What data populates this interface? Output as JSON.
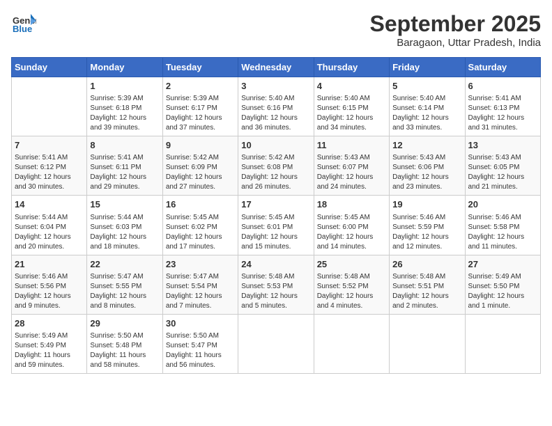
{
  "header": {
    "logo_line1": "General",
    "logo_line2": "Blue",
    "month": "September 2025",
    "location": "Baragaon, Uttar Pradesh, India"
  },
  "weekdays": [
    "Sunday",
    "Monday",
    "Tuesday",
    "Wednesday",
    "Thursday",
    "Friday",
    "Saturday"
  ],
  "weeks": [
    [
      {
        "day": "",
        "info": ""
      },
      {
        "day": "1",
        "info": "Sunrise: 5:39 AM\nSunset: 6:18 PM\nDaylight: 12 hours\nand 39 minutes."
      },
      {
        "day": "2",
        "info": "Sunrise: 5:39 AM\nSunset: 6:17 PM\nDaylight: 12 hours\nand 37 minutes."
      },
      {
        "day": "3",
        "info": "Sunrise: 5:40 AM\nSunset: 6:16 PM\nDaylight: 12 hours\nand 36 minutes."
      },
      {
        "day": "4",
        "info": "Sunrise: 5:40 AM\nSunset: 6:15 PM\nDaylight: 12 hours\nand 34 minutes."
      },
      {
        "day": "5",
        "info": "Sunrise: 5:40 AM\nSunset: 6:14 PM\nDaylight: 12 hours\nand 33 minutes."
      },
      {
        "day": "6",
        "info": "Sunrise: 5:41 AM\nSunset: 6:13 PM\nDaylight: 12 hours\nand 31 minutes."
      }
    ],
    [
      {
        "day": "7",
        "info": "Sunrise: 5:41 AM\nSunset: 6:12 PM\nDaylight: 12 hours\nand 30 minutes."
      },
      {
        "day": "8",
        "info": "Sunrise: 5:41 AM\nSunset: 6:11 PM\nDaylight: 12 hours\nand 29 minutes."
      },
      {
        "day": "9",
        "info": "Sunrise: 5:42 AM\nSunset: 6:09 PM\nDaylight: 12 hours\nand 27 minutes."
      },
      {
        "day": "10",
        "info": "Sunrise: 5:42 AM\nSunset: 6:08 PM\nDaylight: 12 hours\nand 26 minutes."
      },
      {
        "day": "11",
        "info": "Sunrise: 5:43 AM\nSunset: 6:07 PM\nDaylight: 12 hours\nand 24 minutes."
      },
      {
        "day": "12",
        "info": "Sunrise: 5:43 AM\nSunset: 6:06 PM\nDaylight: 12 hours\nand 23 minutes."
      },
      {
        "day": "13",
        "info": "Sunrise: 5:43 AM\nSunset: 6:05 PM\nDaylight: 12 hours\nand 21 minutes."
      }
    ],
    [
      {
        "day": "14",
        "info": "Sunrise: 5:44 AM\nSunset: 6:04 PM\nDaylight: 12 hours\nand 20 minutes."
      },
      {
        "day": "15",
        "info": "Sunrise: 5:44 AM\nSunset: 6:03 PM\nDaylight: 12 hours\nand 18 minutes."
      },
      {
        "day": "16",
        "info": "Sunrise: 5:45 AM\nSunset: 6:02 PM\nDaylight: 12 hours\nand 17 minutes."
      },
      {
        "day": "17",
        "info": "Sunrise: 5:45 AM\nSunset: 6:01 PM\nDaylight: 12 hours\nand 15 minutes."
      },
      {
        "day": "18",
        "info": "Sunrise: 5:45 AM\nSunset: 6:00 PM\nDaylight: 12 hours\nand 14 minutes."
      },
      {
        "day": "19",
        "info": "Sunrise: 5:46 AM\nSunset: 5:59 PM\nDaylight: 12 hours\nand 12 minutes."
      },
      {
        "day": "20",
        "info": "Sunrise: 5:46 AM\nSunset: 5:58 PM\nDaylight: 12 hours\nand 11 minutes."
      }
    ],
    [
      {
        "day": "21",
        "info": "Sunrise: 5:46 AM\nSunset: 5:56 PM\nDaylight: 12 hours\nand 9 minutes."
      },
      {
        "day": "22",
        "info": "Sunrise: 5:47 AM\nSunset: 5:55 PM\nDaylight: 12 hours\nand 8 minutes."
      },
      {
        "day": "23",
        "info": "Sunrise: 5:47 AM\nSunset: 5:54 PM\nDaylight: 12 hours\nand 7 minutes."
      },
      {
        "day": "24",
        "info": "Sunrise: 5:48 AM\nSunset: 5:53 PM\nDaylight: 12 hours\nand 5 minutes."
      },
      {
        "day": "25",
        "info": "Sunrise: 5:48 AM\nSunset: 5:52 PM\nDaylight: 12 hours\nand 4 minutes."
      },
      {
        "day": "26",
        "info": "Sunrise: 5:48 AM\nSunset: 5:51 PM\nDaylight: 12 hours\nand 2 minutes."
      },
      {
        "day": "27",
        "info": "Sunrise: 5:49 AM\nSunset: 5:50 PM\nDaylight: 12 hours\nand 1 minute."
      }
    ],
    [
      {
        "day": "28",
        "info": "Sunrise: 5:49 AM\nSunset: 5:49 PM\nDaylight: 11 hours\nand 59 minutes."
      },
      {
        "day": "29",
        "info": "Sunrise: 5:50 AM\nSunset: 5:48 PM\nDaylight: 11 hours\nand 58 minutes."
      },
      {
        "day": "30",
        "info": "Sunrise: 5:50 AM\nSunset: 5:47 PM\nDaylight: 11 hours\nand 56 minutes."
      },
      {
        "day": "",
        "info": ""
      },
      {
        "day": "",
        "info": ""
      },
      {
        "day": "",
        "info": ""
      },
      {
        "day": "",
        "info": ""
      }
    ]
  ]
}
